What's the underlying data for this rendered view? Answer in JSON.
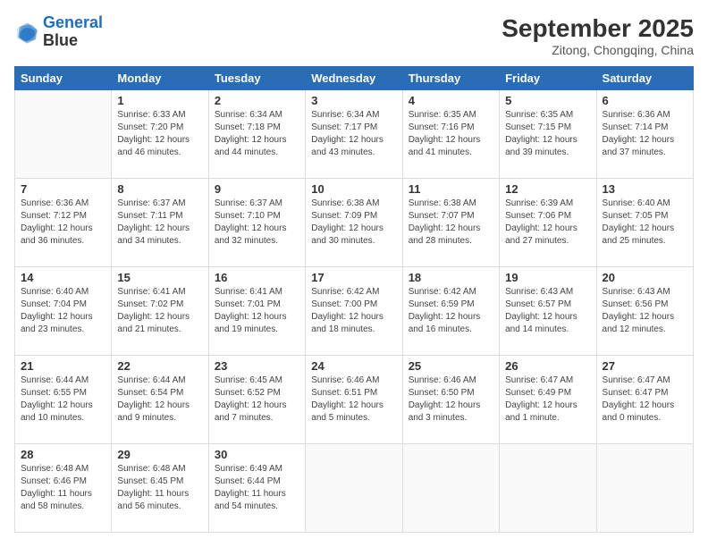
{
  "header": {
    "logo_line1": "General",
    "logo_line2": "Blue",
    "main_title": "September 2025",
    "subtitle": "Zitong, Chongqing, China"
  },
  "weekdays": [
    "Sunday",
    "Monday",
    "Tuesday",
    "Wednesday",
    "Thursday",
    "Friday",
    "Saturday"
  ],
  "weeks": [
    [
      {
        "day": "",
        "info": ""
      },
      {
        "day": "1",
        "info": "Sunrise: 6:33 AM\nSunset: 7:20 PM\nDaylight: 12 hours\nand 46 minutes."
      },
      {
        "day": "2",
        "info": "Sunrise: 6:34 AM\nSunset: 7:18 PM\nDaylight: 12 hours\nand 44 minutes."
      },
      {
        "day": "3",
        "info": "Sunrise: 6:34 AM\nSunset: 7:17 PM\nDaylight: 12 hours\nand 43 minutes."
      },
      {
        "day": "4",
        "info": "Sunrise: 6:35 AM\nSunset: 7:16 PM\nDaylight: 12 hours\nand 41 minutes."
      },
      {
        "day": "5",
        "info": "Sunrise: 6:35 AM\nSunset: 7:15 PM\nDaylight: 12 hours\nand 39 minutes."
      },
      {
        "day": "6",
        "info": "Sunrise: 6:36 AM\nSunset: 7:14 PM\nDaylight: 12 hours\nand 37 minutes."
      }
    ],
    [
      {
        "day": "7",
        "info": "Sunrise: 6:36 AM\nSunset: 7:12 PM\nDaylight: 12 hours\nand 36 minutes."
      },
      {
        "day": "8",
        "info": "Sunrise: 6:37 AM\nSunset: 7:11 PM\nDaylight: 12 hours\nand 34 minutes."
      },
      {
        "day": "9",
        "info": "Sunrise: 6:37 AM\nSunset: 7:10 PM\nDaylight: 12 hours\nand 32 minutes."
      },
      {
        "day": "10",
        "info": "Sunrise: 6:38 AM\nSunset: 7:09 PM\nDaylight: 12 hours\nand 30 minutes."
      },
      {
        "day": "11",
        "info": "Sunrise: 6:38 AM\nSunset: 7:07 PM\nDaylight: 12 hours\nand 28 minutes."
      },
      {
        "day": "12",
        "info": "Sunrise: 6:39 AM\nSunset: 7:06 PM\nDaylight: 12 hours\nand 27 minutes."
      },
      {
        "day": "13",
        "info": "Sunrise: 6:40 AM\nSunset: 7:05 PM\nDaylight: 12 hours\nand 25 minutes."
      }
    ],
    [
      {
        "day": "14",
        "info": "Sunrise: 6:40 AM\nSunset: 7:04 PM\nDaylight: 12 hours\nand 23 minutes."
      },
      {
        "day": "15",
        "info": "Sunrise: 6:41 AM\nSunset: 7:02 PM\nDaylight: 12 hours\nand 21 minutes."
      },
      {
        "day": "16",
        "info": "Sunrise: 6:41 AM\nSunset: 7:01 PM\nDaylight: 12 hours\nand 19 minutes."
      },
      {
        "day": "17",
        "info": "Sunrise: 6:42 AM\nSunset: 7:00 PM\nDaylight: 12 hours\nand 18 minutes."
      },
      {
        "day": "18",
        "info": "Sunrise: 6:42 AM\nSunset: 6:59 PM\nDaylight: 12 hours\nand 16 minutes."
      },
      {
        "day": "19",
        "info": "Sunrise: 6:43 AM\nSunset: 6:57 PM\nDaylight: 12 hours\nand 14 minutes."
      },
      {
        "day": "20",
        "info": "Sunrise: 6:43 AM\nSunset: 6:56 PM\nDaylight: 12 hours\nand 12 minutes."
      }
    ],
    [
      {
        "day": "21",
        "info": "Sunrise: 6:44 AM\nSunset: 6:55 PM\nDaylight: 12 hours\nand 10 minutes."
      },
      {
        "day": "22",
        "info": "Sunrise: 6:44 AM\nSunset: 6:54 PM\nDaylight: 12 hours\nand 9 minutes."
      },
      {
        "day": "23",
        "info": "Sunrise: 6:45 AM\nSunset: 6:52 PM\nDaylight: 12 hours\nand 7 minutes."
      },
      {
        "day": "24",
        "info": "Sunrise: 6:46 AM\nSunset: 6:51 PM\nDaylight: 12 hours\nand 5 minutes."
      },
      {
        "day": "25",
        "info": "Sunrise: 6:46 AM\nSunset: 6:50 PM\nDaylight: 12 hours\nand 3 minutes."
      },
      {
        "day": "26",
        "info": "Sunrise: 6:47 AM\nSunset: 6:49 PM\nDaylight: 12 hours\nand 1 minute."
      },
      {
        "day": "27",
        "info": "Sunrise: 6:47 AM\nSunset: 6:47 PM\nDaylight: 12 hours\nand 0 minutes."
      }
    ],
    [
      {
        "day": "28",
        "info": "Sunrise: 6:48 AM\nSunset: 6:46 PM\nDaylight: 11 hours\nand 58 minutes."
      },
      {
        "day": "29",
        "info": "Sunrise: 6:48 AM\nSunset: 6:45 PM\nDaylight: 11 hours\nand 56 minutes."
      },
      {
        "day": "30",
        "info": "Sunrise: 6:49 AM\nSunset: 6:44 PM\nDaylight: 11 hours\nand 54 minutes."
      },
      {
        "day": "",
        "info": ""
      },
      {
        "day": "",
        "info": ""
      },
      {
        "day": "",
        "info": ""
      },
      {
        "day": "",
        "info": ""
      }
    ]
  ]
}
